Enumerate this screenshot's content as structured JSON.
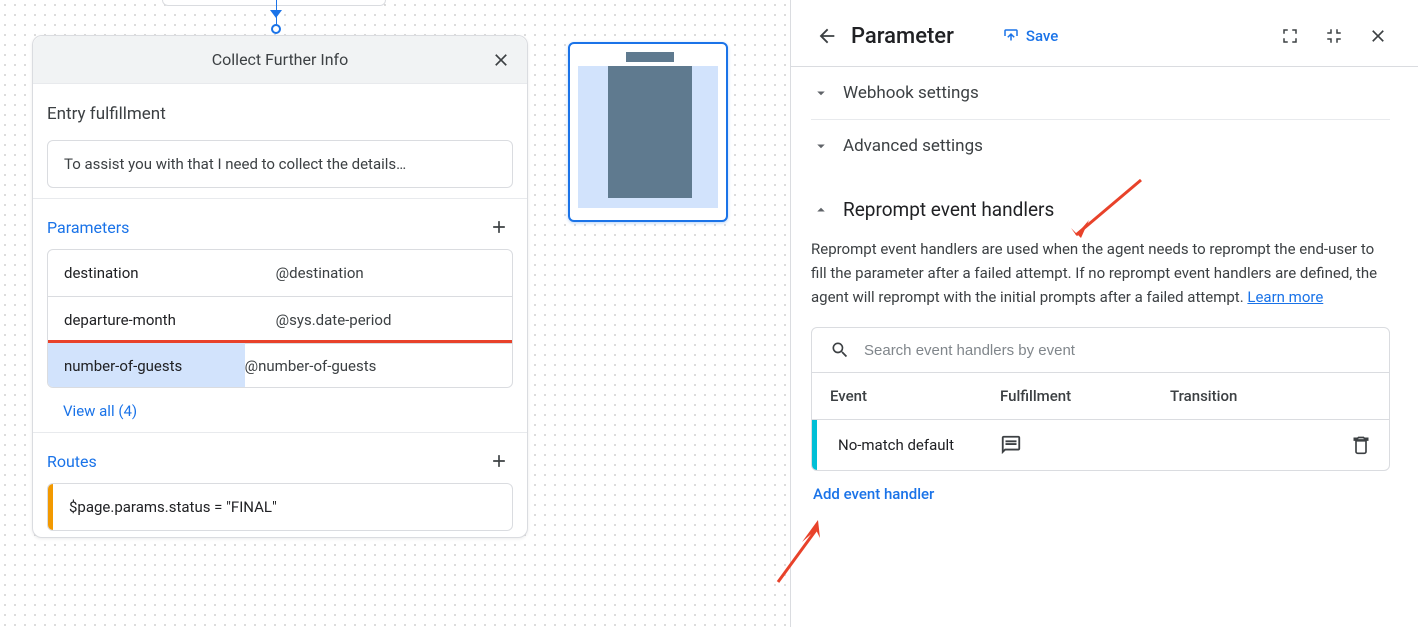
{
  "page_card": {
    "title": "Collect Further Info",
    "entry_label": "Entry fulfillment",
    "entry_text": "To assist you with that I need to collect the details…",
    "parameters_label": "Parameters",
    "params": [
      {
        "name": "destination",
        "type": "@destination"
      },
      {
        "name": "departure-month",
        "type": "@sys.date-period"
      },
      {
        "name": "number-of-guests",
        "type": "@number-of-guests"
      }
    ],
    "view_all": "View all (4)",
    "routes_label": "Routes",
    "route_text": "$page.params.status = \"FINAL\""
  },
  "panel": {
    "title": "Parameter",
    "save": "Save",
    "webhook_label": "Webhook settings",
    "advanced_label": "Advanced settings",
    "reprompt_title": "Reprompt event handlers",
    "reprompt_desc_1": "Reprompt event handlers are used when the agent needs to reprompt the end-user to fill the parameter after a failed attempt. If no reprompt event handlers are defined, the agent will reprompt with the initial prompts after a failed attempt. ",
    "learn_more": "Learn more",
    "search_placeholder": "Search event handlers by event",
    "th_event": "Event",
    "th_fulfill": "Fulfillment",
    "th_trans": "Transition",
    "row_event": "No-match default",
    "add_handler": "Add event handler"
  }
}
